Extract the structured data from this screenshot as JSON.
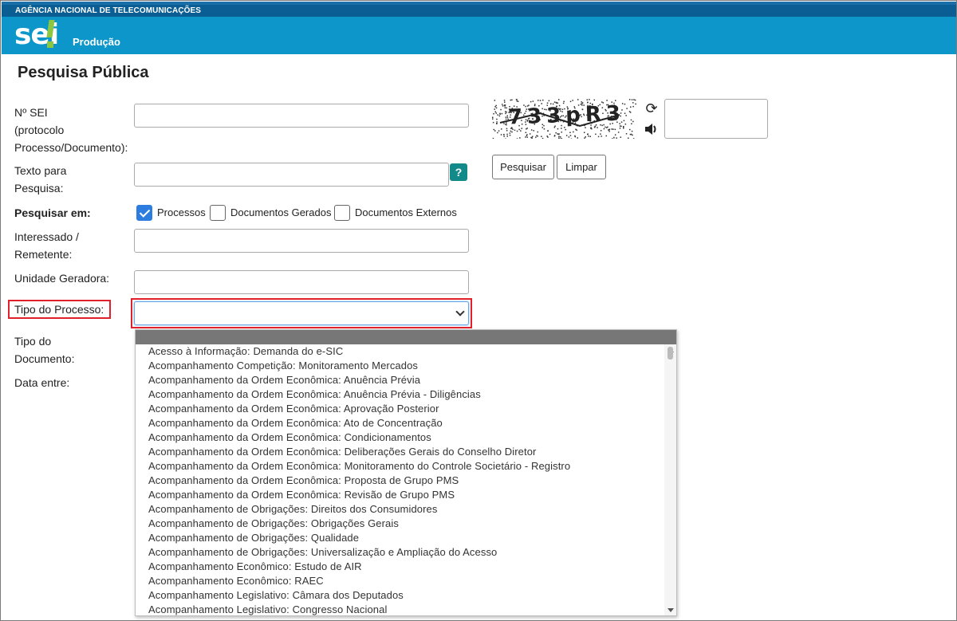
{
  "header": {
    "agency": "AGÊNCIA NACIONAL DE TELECOMUNICAÇÕES",
    "logo_text": "sei",
    "environment": "Produção"
  },
  "page": {
    "title": "Pesquisa Pública"
  },
  "form": {
    "nsei_label": "Nº SEI (protocolo Processo/Documento):",
    "nsei_line1": "Nº SEI",
    "nsei_line2": "(protocolo",
    "nsei_line3": "Processo/Documento):",
    "texto_line1": "Texto para",
    "texto_line2": "Pesquisa:",
    "help_label": "?",
    "pesquisar_em_label": "Pesquisar em:",
    "checkboxes": [
      {
        "label": "Processos",
        "checked": true
      },
      {
        "label": "Documentos Gerados",
        "checked": false
      },
      {
        "label": "Documentos Externos",
        "checked": false
      }
    ],
    "interessado_line1": "Interessado /",
    "interessado_line2": "Remetente:",
    "unidade_label": "Unidade Geradora:",
    "tipo_processo_label": "Tipo do Processo:",
    "tipo_processo_value": "",
    "tipo_documento_line1": "Tipo do",
    "tipo_documento_line2": "Documento:",
    "data_label": "Data entre:"
  },
  "dropdown": {
    "options": [
      "Acesso à Informação: Demanda do e-SIC",
      "Acompanhamento Competição: Monitoramento Mercados",
      "Acompanhamento da Ordem Econômica: Anuência Prévia",
      "Acompanhamento da Ordem Econômica: Anuência Prévia - Diligências",
      "Acompanhamento da Ordem Econômica: Aprovação Posterior",
      "Acompanhamento da Ordem Econômica: Ato de Concentração",
      "Acompanhamento da Ordem Econômica: Condicionamentos",
      "Acompanhamento da Ordem Econômica: Deliberações Gerais do Conselho Diretor",
      "Acompanhamento da Ordem Econômica: Monitoramento do Controle Societário - Registro",
      "Acompanhamento da Ordem Econômica: Proposta de Grupo PMS",
      "Acompanhamento da Ordem Econômica: Revisão de Grupo PMS",
      "Acompanhamento de Obrigações: Direitos dos Consumidores",
      "Acompanhamento de Obrigações: Obrigações Gerais",
      "Acompanhamento de Obrigações: Qualidade",
      "Acompanhamento de Obrigações: Universalização e Ampliação do Acesso",
      "Acompanhamento Econômico: Estudo de AIR",
      "Acompanhamento Econômico: RAEC",
      "Acompanhamento Legislativo: Câmara dos Deputados",
      "Acompanhamento Legislativo: Congresso Nacional"
    ]
  },
  "captcha": {
    "text": "733pR3",
    "refresh_icon": "refresh-icon",
    "audio_icon": "speaker-icon"
  },
  "buttons": {
    "search": "Pesquisar",
    "clear": "Limpar"
  },
  "colors": {
    "brand_blue": "#0c96c9",
    "agency_bar": "#0b5e93",
    "logo_green": "#8dc63f",
    "help_teal": "#128a8a",
    "checkbox_blue": "#2d7de0",
    "highlight_red": "#e0202a"
  }
}
